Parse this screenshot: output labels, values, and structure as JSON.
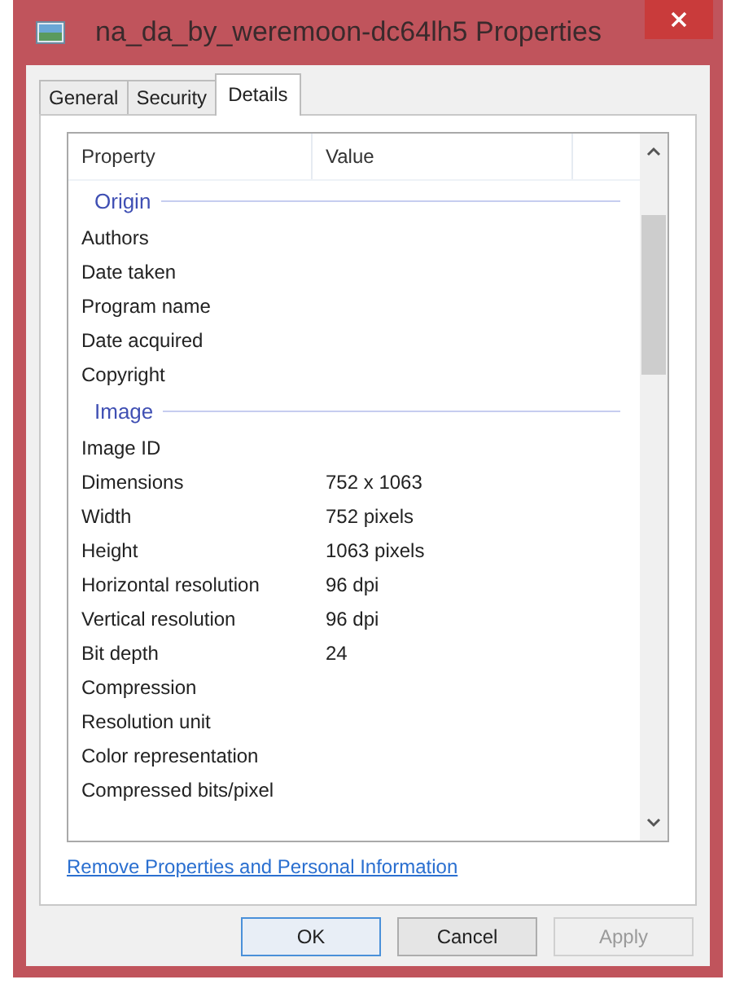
{
  "window": {
    "title": "na_da_by_weremoon-dc64lh5 Properties"
  },
  "tabs": [
    {
      "label": "General",
      "selected": false
    },
    {
      "label": "Security",
      "selected": false
    },
    {
      "label": "Details",
      "selected": true
    }
  ],
  "table": {
    "columns": [
      "Property",
      "Value"
    ],
    "rows": [
      {
        "kind": "group",
        "property": "Origin"
      },
      {
        "kind": "property",
        "property": "Authors"
      },
      {
        "kind": "property",
        "property": "Date taken"
      },
      {
        "kind": "property",
        "property": "Program name"
      },
      {
        "kind": "property",
        "property": "Date acquired"
      },
      {
        "kind": "property",
        "property": "Copyright"
      },
      {
        "kind": "group",
        "property": "Image"
      },
      {
        "kind": "property",
        "property": "Image ID"
      },
      {
        "kind": "property",
        "property": "Dimensions",
        "value": "752 x 1063"
      },
      {
        "kind": "property",
        "property": "Width",
        "value": "752 pixels"
      },
      {
        "kind": "property",
        "property": "Height",
        "value": "1063 pixels"
      },
      {
        "kind": "property",
        "property": "Horizontal resolution",
        "value": "96 dpi"
      },
      {
        "kind": "property",
        "property": "Vertical resolution",
        "value": "96 dpi"
      },
      {
        "kind": "property",
        "property": "Bit depth",
        "value": "24"
      },
      {
        "kind": "property",
        "property": "Compression"
      },
      {
        "kind": "property",
        "property": "Resolution unit"
      },
      {
        "kind": "property",
        "property": "Color representation"
      },
      {
        "kind": "property",
        "property": "Compressed bits/pixel"
      }
    ]
  },
  "link": "Remove Properties and Personal Information",
  "buttons": [
    {
      "label": "OK",
      "disabled": false
    },
    {
      "label": "Cancel",
      "disabled": false
    },
    {
      "label": "Apply",
      "disabled": true
    }
  ]
}
